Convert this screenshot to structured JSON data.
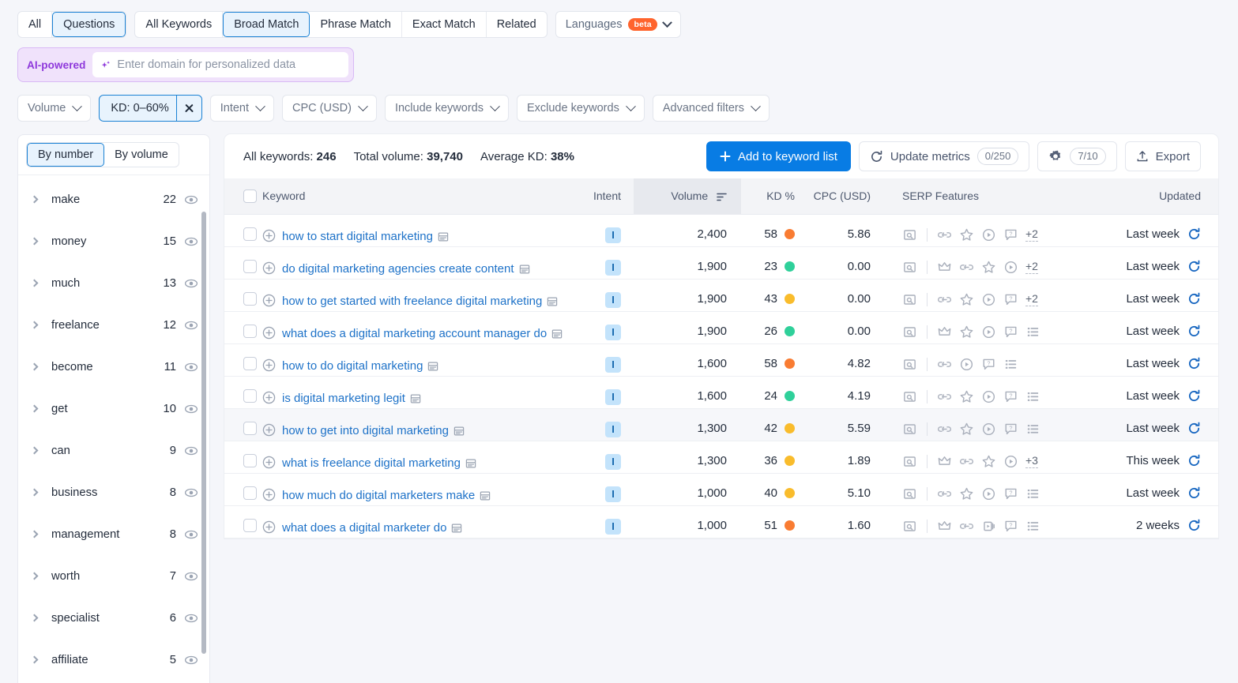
{
  "tabs": {
    "group1": [
      {
        "label": "All",
        "active": false
      },
      {
        "label": "Questions",
        "active": true
      }
    ],
    "group2": [
      {
        "label": "All Keywords",
        "active": false
      },
      {
        "label": "Broad Match",
        "active": true
      },
      {
        "label": "Phrase Match",
        "active": false
      },
      {
        "label": "Exact Match",
        "active": false
      },
      {
        "label": "Related",
        "active": false
      }
    ],
    "languages": {
      "label": "Languages",
      "badge": "beta"
    }
  },
  "ai_bar": {
    "label": "AI-powered",
    "placeholder": "Enter domain for personalized data",
    "value": ""
  },
  "filters": [
    {
      "label": "Volume",
      "active": false,
      "clearable": false
    },
    {
      "label": "KD: 0–60%",
      "active": true,
      "clearable": true
    },
    {
      "label": "Intent",
      "active": false,
      "clearable": false
    },
    {
      "label": "CPC (USD)",
      "active": false,
      "clearable": false
    },
    {
      "label": "Include keywords",
      "active": false,
      "clearable": false
    },
    {
      "label": "Exclude keywords",
      "active": false,
      "clearable": false
    },
    {
      "label": "Advanced filters",
      "active": false,
      "clearable": false
    }
  ],
  "sidebar": {
    "toggle": [
      {
        "label": "By number",
        "active": true
      },
      {
        "label": "By volume",
        "active": false
      }
    ],
    "items": [
      {
        "label": "make",
        "count": "22"
      },
      {
        "label": "money",
        "count": "15"
      },
      {
        "label": "much",
        "count": "13"
      },
      {
        "label": "freelance",
        "count": "12"
      },
      {
        "label": "become",
        "count": "11"
      },
      {
        "label": "get",
        "count": "10"
      },
      {
        "label": "can",
        "count": "9"
      },
      {
        "label": "business",
        "count": "8"
      },
      {
        "label": "management",
        "count": "8"
      },
      {
        "label": "worth",
        "count": "7"
      },
      {
        "label": "specialist",
        "count": "6"
      },
      {
        "label": "affiliate",
        "count": "5"
      }
    ]
  },
  "toolbar": {
    "stat_all_keywords_label": "All keywords:",
    "stat_all_keywords_value": "246",
    "stat_total_volume_label": "Total volume:",
    "stat_total_volume_value": "39,740",
    "stat_avg_kd_label": "Average KD:",
    "stat_avg_kd_value": "38%",
    "add_to_list_label": "Add to keyword list",
    "update_metrics_label": "Update metrics",
    "update_metrics_counter": "0/250",
    "settings_counter": "7/10",
    "export_label": "Export"
  },
  "table": {
    "columns": {
      "keyword": "Keyword",
      "intent": "Intent",
      "volume": "Volume",
      "kd": "KD %",
      "cpc": "CPC (USD)",
      "serp": "SERP Features",
      "updated": "Updated"
    },
    "sorted_column": "volume",
    "kd_colors": {
      "green": "#2fd09a",
      "yellow": "#f9bc2c",
      "orange": "#f97c32"
    },
    "rows": [
      {
        "keyword": "how to start digital marketing",
        "intent": "I",
        "volume": "2,400",
        "kd": "58",
        "kd_color": "orange",
        "cpc": "5.86",
        "serp": [
          "sitelinks",
          "reviews",
          "video",
          "faq"
        ],
        "serp_more": "+2",
        "updated": "Last week",
        "highlighted": false
      },
      {
        "keyword": "do digital marketing agencies create content",
        "intent": "I",
        "volume": "1,900",
        "kd": "23",
        "kd_color": "green",
        "cpc": "0.00",
        "serp": [
          "top-stories",
          "sitelinks",
          "reviews",
          "video"
        ],
        "serp_more": "+2",
        "updated": "Last week",
        "highlighted": false
      },
      {
        "keyword": "how to get started with freelance digital marketing",
        "intent": "I",
        "volume": "1,900",
        "kd": "43",
        "kd_color": "yellow",
        "cpc": "0.00",
        "serp": [
          "sitelinks",
          "reviews",
          "video",
          "faq"
        ],
        "serp_more": "+2",
        "updated": "Last week",
        "highlighted": false
      },
      {
        "keyword": "what does a digital marketing account manager do",
        "intent": "I",
        "volume": "1,900",
        "kd": "26",
        "kd_color": "green",
        "cpc": "0.00",
        "serp": [
          "top-stories",
          "reviews",
          "video",
          "faq",
          "related"
        ],
        "serp_more": "",
        "updated": "Last week",
        "highlighted": false
      },
      {
        "keyword": "how to do digital marketing",
        "intent": "I",
        "volume": "1,600",
        "kd": "58",
        "kd_color": "orange",
        "cpc": "4.82",
        "serp": [
          "sitelinks",
          "video",
          "faq",
          "related"
        ],
        "serp_more": "",
        "updated": "Last week",
        "highlighted": false
      },
      {
        "keyword": "is digital marketing legit",
        "intent": "I",
        "volume": "1,600",
        "kd": "24",
        "kd_color": "green",
        "cpc": "4.19",
        "serp": [
          "sitelinks",
          "reviews",
          "video",
          "faq",
          "related"
        ],
        "serp_more": "",
        "updated": "Last week",
        "highlighted": false
      },
      {
        "keyword": "how to get into digital marketing",
        "intent": "I",
        "volume": "1,300",
        "kd": "42",
        "kd_color": "yellow",
        "cpc": "5.59",
        "serp": [
          "sitelinks",
          "reviews",
          "video",
          "faq",
          "related"
        ],
        "serp_more": "",
        "updated": "Last week",
        "highlighted": true
      },
      {
        "keyword": "what is freelance digital marketing",
        "intent": "I",
        "volume": "1,300",
        "kd": "36",
        "kd_color": "yellow",
        "cpc": "1.89",
        "serp": [
          "top-stories",
          "sitelinks",
          "reviews",
          "video"
        ],
        "serp_more": "+3",
        "updated": "This week",
        "highlighted": false
      },
      {
        "keyword": "how much do digital marketers make",
        "intent": "I",
        "volume": "1,000",
        "kd": "40",
        "kd_color": "yellow",
        "cpc": "5.10",
        "serp": [
          "sitelinks",
          "reviews",
          "video",
          "faq",
          "related"
        ],
        "serp_more": "",
        "updated": "Last week",
        "highlighted": false
      },
      {
        "keyword": "what does a digital marketer do",
        "intent": "I",
        "volume": "1,000",
        "kd": "51",
        "kd_color": "orange",
        "cpc": "1.60",
        "serp": [
          "top-stories",
          "sitelinks",
          "video-carousel",
          "faq",
          "related"
        ],
        "serp_more": "",
        "updated": "2 weeks",
        "highlighted": false
      }
    ]
  }
}
